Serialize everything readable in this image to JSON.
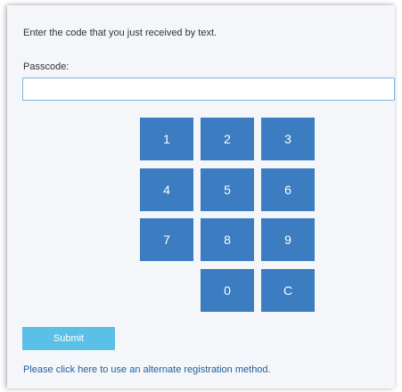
{
  "instructions": "Enter the code that you just received by text.",
  "passcode": {
    "label": "Passcode:",
    "value": "",
    "placeholder": ""
  },
  "keypad": {
    "keys": [
      "1",
      "2",
      "3",
      "4",
      "5",
      "6",
      "7",
      "8",
      "9",
      "0",
      "C"
    ]
  },
  "submit_label": "Submit",
  "alternate_link": "Please click here to use an alternate registration method.",
  "colors": {
    "key_background": "#3b7dc0",
    "submit_background": "#5bc0e8",
    "link": "#1f5e9e",
    "panel_background": "#f4f6f9"
  }
}
